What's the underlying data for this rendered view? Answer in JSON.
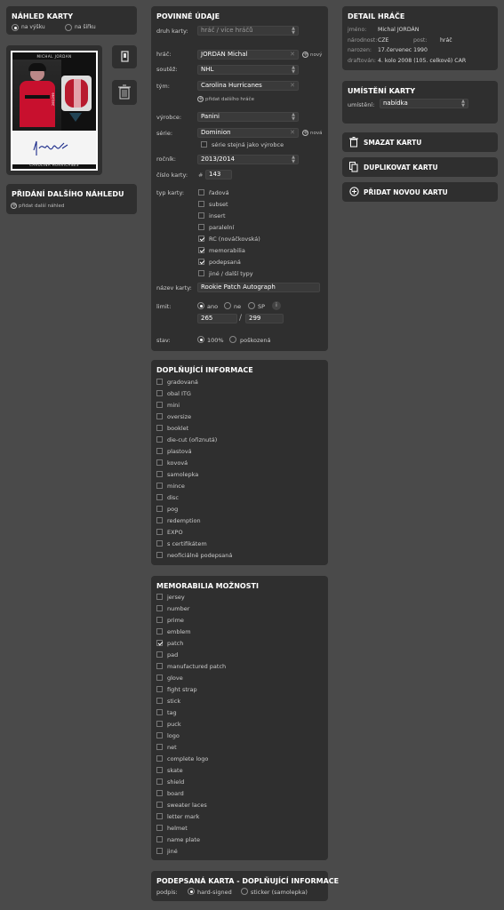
{
  "preview": {
    "title": "NÁHLED KARTY",
    "orientation_portrait": "na výšku",
    "orientation_landscape": "na šířku",
    "card_brand": "MICHAL JORDAN",
    "card_team": "CAROLINA HURRICANES",
    "card_serial": "265/299"
  },
  "add_preview": {
    "title": "PŘIDÁNÍ DALŠÍHO NÁHLEDU",
    "link": "přidat další náhled"
  },
  "required": {
    "title": "POVINNÉ ÚDAJE",
    "card_kind_label": "druh karty:",
    "card_kind_placeholder": "hráč / více hráčů",
    "player_label": "hráč:",
    "player_value": "JORDÁN Michal",
    "new_label": "nový",
    "competition_label": "soutěž:",
    "competition_value": "NHL",
    "team_label": "tým:",
    "team_value": "Carolina Hurricanes",
    "add_player_link": "přidat dalšího hráče",
    "manufacturer_label": "výrobce:",
    "manufacturer_value": "Panini",
    "series_label": "série:",
    "series_value": "Dominion",
    "series_new": "nová",
    "same_as_maker": "série stejná jako výrobce",
    "year_label": "ročník:",
    "year_value": "2013/2014",
    "number_label": "číslo karty:",
    "number_hash": "#",
    "number_value": "143",
    "type_label": "typ karty:",
    "types": [
      {
        "label": "řadová",
        "checked": false
      },
      {
        "label": "subset",
        "checked": false
      },
      {
        "label": "insert",
        "checked": false
      },
      {
        "label": "paralelní",
        "checked": false
      },
      {
        "label": "RC (nováčkovská)",
        "checked": true
      },
      {
        "label": "memorabilia",
        "checked": true
      },
      {
        "label": "podepsaná",
        "checked": true
      },
      {
        "label": "jiné / další typy",
        "checked": false
      }
    ],
    "name_label": "název karty:",
    "name_value": "Rookie Patch Autograph",
    "limit_label": "limit:",
    "limit_yes": "ano",
    "limit_no": "ne",
    "limit_sp": "SP",
    "limit_info": "i",
    "limit_num": "265",
    "limit_sep": "/",
    "limit_total": "299",
    "state_label": "stav:",
    "state_100": "100%",
    "state_damaged": "poškozená"
  },
  "extra": {
    "title": "DOPLŇUJÍCÍ INFORMACE",
    "items": [
      {
        "label": "gradovaná",
        "checked": false
      },
      {
        "label": "obal ITG",
        "checked": false
      },
      {
        "label": "mini",
        "checked": false
      },
      {
        "label": "oversize",
        "checked": false
      },
      {
        "label": "booklet",
        "checked": false
      },
      {
        "label": "die-cut (ořiznutá)",
        "checked": false
      },
      {
        "label": "plastová",
        "checked": false
      },
      {
        "label": "kovová",
        "checked": false
      },
      {
        "label": "samolepka",
        "checked": false
      },
      {
        "label": "mince",
        "checked": false
      },
      {
        "label": "disc",
        "checked": false
      },
      {
        "label": "pog",
        "checked": false
      },
      {
        "label": "redemption",
        "checked": false
      },
      {
        "label": "EXPO",
        "checked": false
      },
      {
        "label": "s certifikátem",
        "checked": false
      },
      {
        "label": "neoficiálně podepsaná",
        "checked": false
      }
    ]
  },
  "memorabilia": {
    "title": "MEMORABILIA MOŽNOSTI",
    "items": [
      {
        "label": "jersey",
        "checked": false
      },
      {
        "label": "number",
        "checked": false
      },
      {
        "label": "prime",
        "checked": false
      },
      {
        "label": "emblem",
        "checked": false
      },
      {
        "label": "patch",
        "checked": true
      },
      {
        "label": "pad",
        "checked": false
      },
      {
        "label": "manufactured patch",
        "checked": false
      },
      {
        "label": "glove",
        "checked": false
      },
      {
        "label": "fight strap",
        "checked": false
      },
      {
        "label": "stick",
        "checked": false
      },
      {
        "label": "tag",
        "checked": false
      },
      {
        "label": "puck",
        "checked": false
      },
      {
        "label": "logo",
        "checked": false
      },
      {
        "label": "net",
        "checked": false
      },
      {
        "label": "complete logo",
        "checked": false
      },
      {
        "label": "skate",
        "checked": false
      },
      {
        "label": "shield",
        "checked": false
      },
      {
        "label": "board",
        "checked": false
      },
      {
        "label": "sweater laces",
        "checked": false
      },
      {
        "label": "letter mark",
        "checked": false
      },
      {
        "label": "helmet",
        "checked": false
      },
      {
        "label": "name plate",
        "checked": false
      },
      {
        "label": "jiné",
        "checked": false
      }
    ]
  },
  "signed": {
    "title": "PODEPSANÁ KARTA - DOPLŇUJÍCÍ INFORMACE",
    "label": "podpis:",
    "hard": "hard-signed",
    "sticker": "sticker (samolepka)"
  },
  "player_detail": {
    "title": "DETAIL HRÁČE",
    "name_k": "jméno:",
    "name_v": "Michal JORDÁN",
    "nat_k": "národnost:",
    "nat_v": "CZE",
    "pos_k": "post:",
    "pos_v": "hráč",
    "born_k": "narozen:",
    "born_v": "17.červenec 1990",
    "draft_k": "draftován:",
    "draft_v": "4. kolo 2008 (105. celkově) CAR"
  },
  "location": {
    "title": "UMÍSTĚNÍ KARTY",
    "label": "umístění:",
    "value": "nabídka"
  },
  "actions": {
    "delete": "SMAZAT KARTU",
    "duplicate": "DUPLIKOVAT KARTU",
    "add_new": "PŘIDAT NOVOU KARTU"
  },
  "colors": {
    "background": "#4a4a4a",
    "panel": "#2f2f2f",
    "card_red": "#c8102e"
  }
}
